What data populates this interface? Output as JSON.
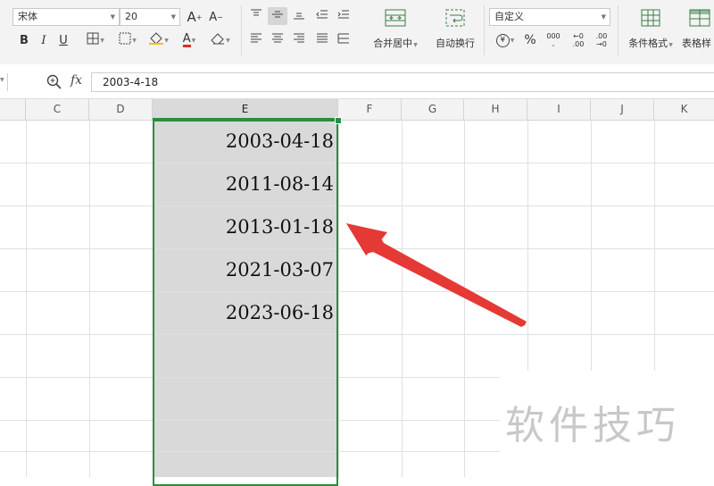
{
  "ribbon": {
    "font_name": "宋体",
    "font_size": "20",
    "bold": "B",
    "italic": "I",
    "underline": "U",
    "merge_center_label": "合并居中",
    "auto_wrap_label": "自动换行",
    "number_format": "自定义",
    "percent": "%",
    "thousands": "000",
    "inc_decimal": ".00",
    "dec_decimal": ".00",
    "conditional_format_label": "条件格式",
    "table_style_label": "表格样"
  },
  "formula_bar": {
    "fx_label": "fx",
    "value": "2003-4-18"
  },
  "grid": {
    "columns": [
      "C",
      "D",
      "E",
      "F",
      "G",
      "H",
      "I",
      "J",
      "K"
    ],
    "selected_column": "E",
    "cells": [
      "2003-04-18",
      "2011-08-14",
      "2013-01-18",
      "2021-03-07",
      "2023-06-18"
    ]
  },
  "annotation": {
    "arrow_color": "#e53935"
  },
  "watermark": "软件技巧",
  "colors": {
    "selection_border": "#2e8b3f",
    "selection_fill": "#d9d9d9"
  }
}
